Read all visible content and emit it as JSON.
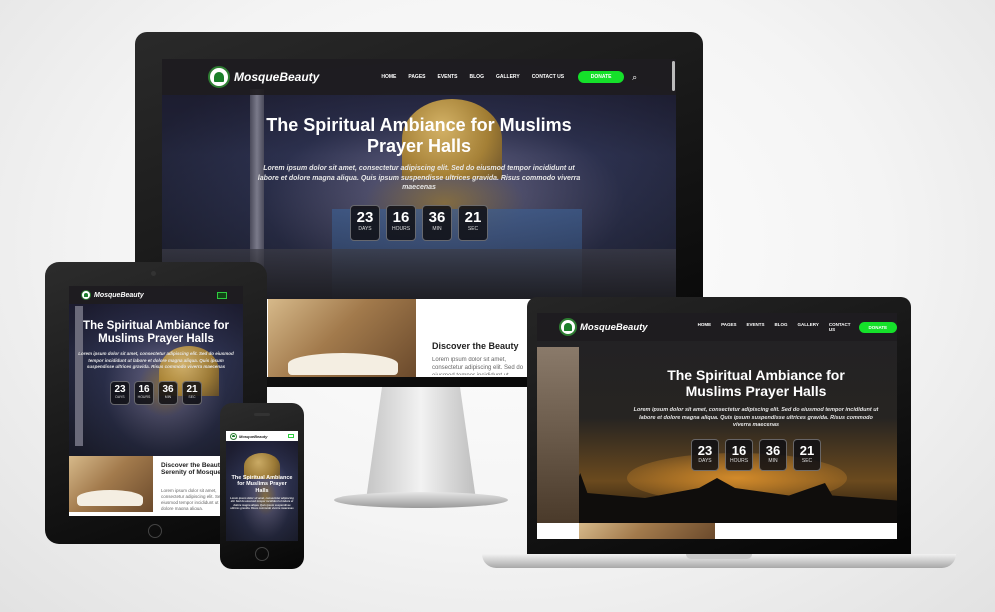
{
  "site": {
    "logo_text": "MosqueBeauty",
    "nav": [
      "HOME",
      "PAGES",
      "EVENTS",
      "BLOG",
      "GALLERY",
      "CONTACT US"
    ],
    "donate_label": "DONATE",
    "hero_title": "The Spiritual Ambiance for Muslims Prayer Halls",
    "hero_subtitle": "Lorem ipsum dolor sit amet, consectetur adipiscing elit. Sed do eiusmod tempor incididunt ut labore et dolore magna aliqua. Quis ipsum suspendisse ultrices gravida. Risus commodo viverra maecenas",
    "countdown": [
      {
        "value": "23",
        "label": "DAYS"
      },
      {
        "value": "16",
        "label": "HOURS"
      },
      {
        "value": "36",
        "label": "MIN"
      },
      {
        "value": "21",
        "label": "SEC"
      }
    ],
    "section2_title": "Discover the Beauty and Serenity of Mosques",
    "section2_title_desktop": "Discover the Beauty",
    "section2_text": "Lorem ipsum dolor sit amet, consectetur adipiscing elit. Sed do eiusmod tempor incididunt ut labore et dolore magna aliqua."
  },
  "colors": {
    "donate": "#15e02a",
    "logo_green": "#1b7f2a",
    "navbar": "#1e1c20"
  }
}
